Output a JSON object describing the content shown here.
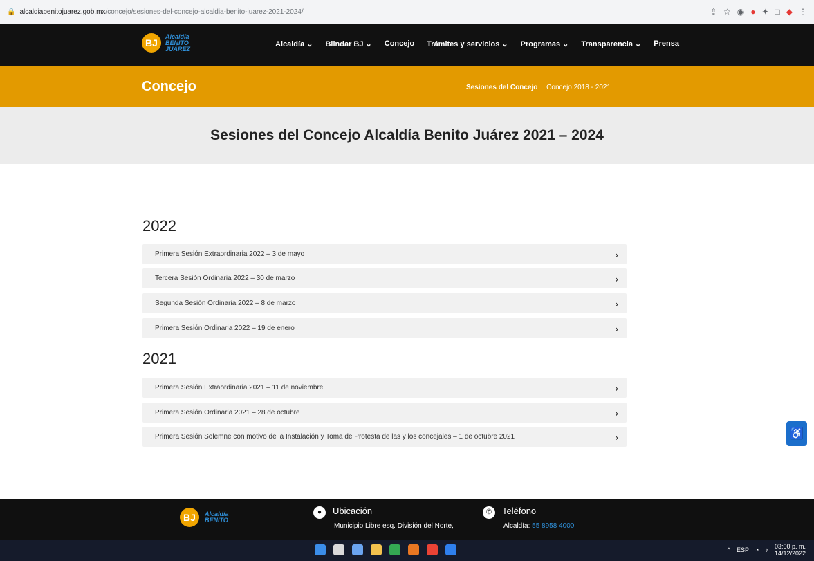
{
  "browser": {
    "host": "alcaldiabenitojuarez.gob.mx",
    "path": "/concejo/sesiones-del-concejo-alcaldia-benito-juarez-2021-2024/"
  },
  "nav": {
    "logo_line1": "Alcaldía",
    "logo_line2": "BENITO",
    "logo_line3": "JUÁREZ",
    "items": [
      {
        "label": "Alcaldía ⌄"
      },
      {
        "label": "Blindar BJ ⌄"
      },
      {
        "label": "Concejo"
      },
      {
        "label": "Trámites y servicios ⌄"
      },
      {
        "label": "Programas ⌄"
      },
      {
        "label": "Transparencia ⌄"
      },
      {
        "label": "Prensa"
      }
    ]
  },
  "banner": {
    "title": "Concejo",
    "breadcrumb_active": "Sesiones del Concejo",
    "breadcrumb_other": "Concejo 2018 - 2021"
  },
  "hero": {
    "heading": "Sesiones del Concejo Alcaldía Benito Juárez 2021 – 2024"
  },
  "sections": [
    {
      "year": "2022",
      "items": [
        "Primera Sesión Extraordinaria 2022 – 3 de mayo",
        "Tercera Sesión Ordinaria 2022 – 30 de marzo",
        "Segunda Sesión Ordinaria 2022 – 8 de marzo",
        "Primera Sesión Ordinaria 2022 – 19 de enero"
      ]
    },
    {
      "year": "2021",
      "items": [
        "Primera Sesión Extraordinaria 2021 – 11 de noviembre",
        "Primera Sesión Ordinaria 2021 – 28 de octubre",
        "Primera Sesión Solemne con motivo de la Instalación y Toma de Protesta de las y los concejales – 1 de octubre 2021"
      ]
    }
  ],
  "footer": {
    "location_title": "Ubicación",
    "location_text": "Municipio Libre esq. División del Norte,",
    "phone_title": "Teléfono",
    "phone_label": "Alcaldía:",
    "phone_number": "55 8958 4000"
  },
  "taskbar": {
    "lang": "ESP",
    "time": "03:00 p. m.",
    "date": "14/12/2022"
  }
}
